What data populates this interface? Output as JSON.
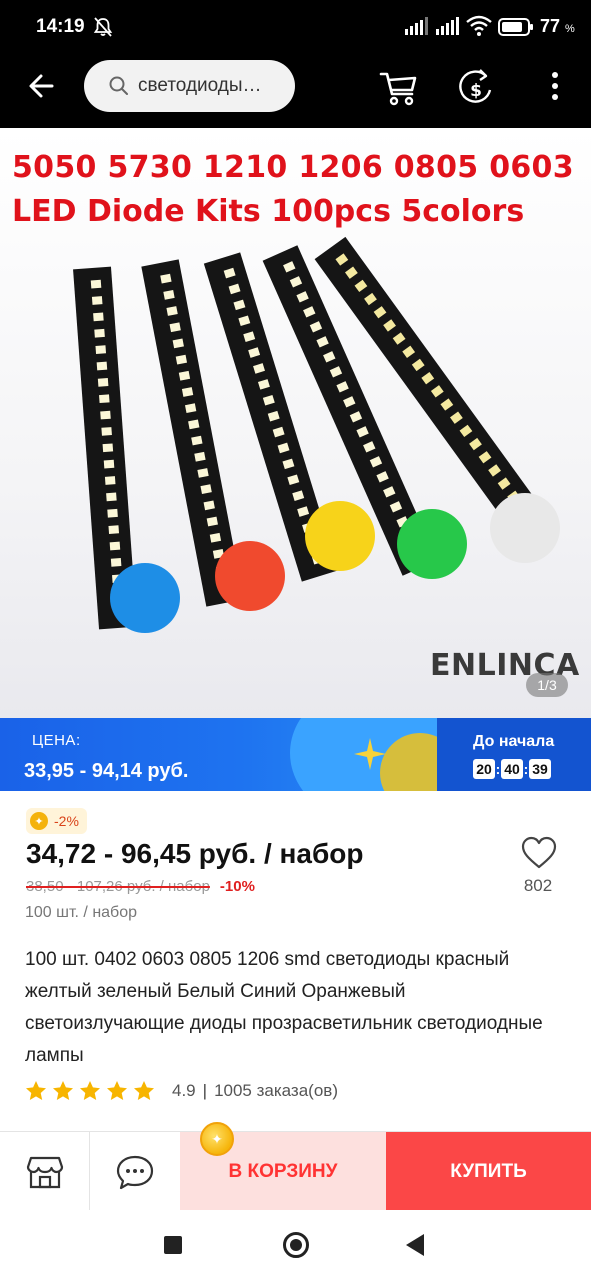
{
  "status_bar": {
    "time": "14:19",
    "battery_percent": "77",
    "battery_unit": "%"
  },
  "toolbar": {
    "search_text": "светодиоды…",
    "icons": [
      "arrow-left-icon",
      "search-icon",
      "cart-icon",
      "coin-dollar-icon",
      "more-vertical-icon"
    ]
  },
  "gallery": {
    "headline_line1": "5050 5730 1210 1206 0805 0603",
    "headline_line2": "LED Diode Kits 100pcs 5colors",
    "brand": "ENLINCA",
    "pager": "1/3",
    "strip_dot_colors": [
      "#1e8ee6",
      "#f04a2e",
      "#f7d31a",
      "#27c84a",
      "#e8e8e8"
    ]
  },
  "sale_banner": {
    "label": "ЦЕНА:",
    "price_range": "33,95 - 94,14 руб.",
    "countdown_label": "До начала",
    "countdown": {
      "h": "20",
      "m": "40",
      "s": "39"
    }
  },
  "price": {
    "discount_chip": "-2%",
    "current": "34,72 - 96,45 руб. / набор",
    "old": "38,50 - 107,26 руб. / набор",
    "old_discount": "-10%",
    "unit_note": "100 шт. / набор"
  },
  "wishlist": {
    "count": "802"
  },
  "product": {
    "title": "100 шт. 0402 0603 0805 1206 smd светодиоды красный желтый зеленый Белый Синий Оранжевый светоизлучающие диоды прозрасветильник светодиодные лампы",
    "rating": "4.9",
    "stars": 5,
    "orders": "1005 заказа(ов)"
  },
  "actions": {
    "add_to_cart": "В КОРЗИНУ",
    "buy": "КУПИТЬ"
  },
  "colors": {
    "accent_red": "#fb4747",
    "banner_blue": "#1e73f0"
  }
}
